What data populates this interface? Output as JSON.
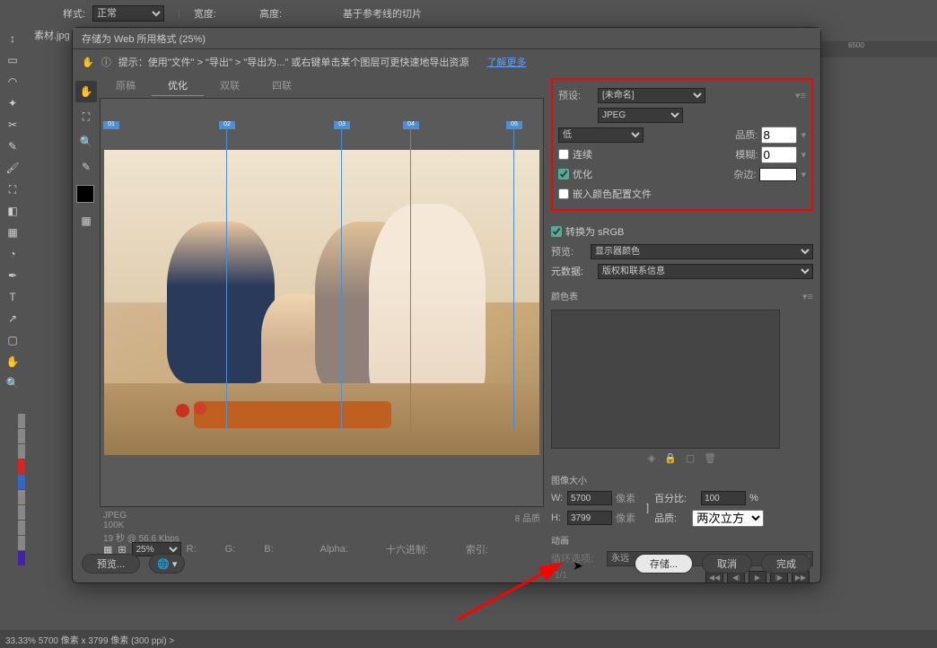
{
  "topbar": {
    "style_label": "样式:",
    "style_value": "正常",
    "width_label": "宽度:",
    "height_label": "高度:",
    "slice_label": "基于参考线的切片"
  },
  "doc_tab": "素材.jpg @",
  "dialog": {
    "title": "存储为 Web 所用格式 (25%)",
    "hint": "提示：使用\"文件\" > \"导出\" > \"导出为...\" 或右键单击某个图层可更快速地导出资源",
    "learn_more": "了解更多"
  },
  "tabs": {
    "original": "原稿",
    "optimized": "优化",
    "two_up": "双联",
    "four_up": "四联"
  },
  "stats": {
    "format": "JPEG",
    "size": "100K",
    "time": "19 秒 @ 56.6 Kbps",
    "quality": "8  品质"
  },
  "inforow": {
    "zoom": "25%",
    "r": "R:",
    "g": "G:",
    "b": "B:",
    "alpha": "Alpha:",
    "hex": "十六进制:",
    "index": "索引:"
  },
  "preset": {
    "label": "预设:",
    "value": "[未命名]",
    "format": "JPEG",
    "quality_preset": "低",
    "quality_label": "品质:",
    "quality_value": "8",
    "progressive": "连续",
    "blur_label": "模糊:",
    "blur_value": "0",
    "optimized": "优化",
    "matte_label": "杂边:",
    "embed_profile": "嵌入颜色配置文件"
  },
  "convert": {
    "srgb": "转换为 sRGB",
    "preview_label": "预览:",
    "preview_value": "显示器颜色",
    "meta_label": "元数据:",
    "meta_value": "版权和联系信息"
  },
  "color_table": {
    "title": "颜色表"
  },
  "image_size": {
    "title": "图像大小",
    "w": "W:",
    "w_val": "5700",
    "h": "H:",
    "h_val": "3799",
    "px": "像素",
    "percent_label": "百分比:",
    "percent_val": "100",
    "pct": "%",
    "quality_label": "品质:",
    "quality_val": "两次立方"
  },
  "animation": {
    "title": "动画",
    "loop_label": "循环选项:",
    "loop_value": "永远",
    "frame": "1/1"
  },
  "buttons": {
    "preview": "预览...",
    "save": "存储...",
    "cancel": "取消",
    "done": "完成"
  },
  "status": "33.33%    5700 像素 x 3799 像素 (300 ppi)   >",
  "ruler": "6500"
}
